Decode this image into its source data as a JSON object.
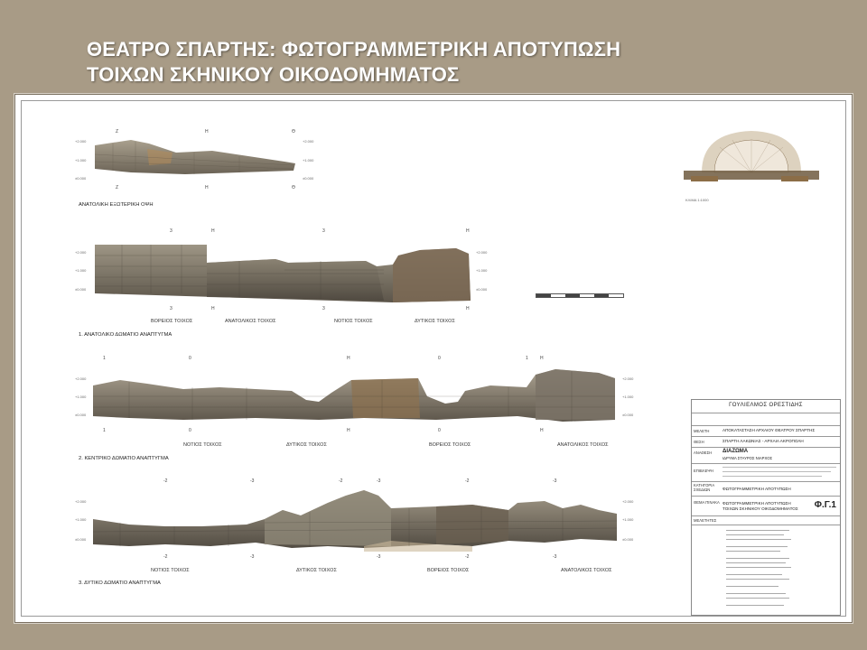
{
  "slide": {
    "title_line1": "ΘΕΑΤΡΟ ΣΠΑΡΤΗΣ: ΦΩΤΟΓΡΑΜΜΕΤΡΙΚΗ ΑΠΟΤΥΠΩΣΗ",
    "title_line2": "ΤΟΙΧΩΝ ΣΚΗΝΙΚΟΥ ΟΙΚΟΔΟΜΗΜΑΤΟΣ"
  },
  "sections": {
    "east_facade": {
      "title": "ΑΝΑΤΟΛΙΚΗ ΕΞΩΤΕΡΙΚΗ ΟΨΗ",
      "marks": [
        "Ζ",
        "Η",
        "Θ"
      ]
    },
    "room1": {
      "title": "1. ΑΝΑΤΟΛΙΚΟ ΔΩΜΑΤΙΟ ΑΝΑΠΤΥΓΜΑ",
      "marks": [
        "3",
        "Η",
        "3",
        "Η"
      ],
      "walls": [
        "ΒΟΡΕΙΟΣ ΤΟΙΧΟΣ",
        "ΑΝΑΤΟΛΙΚΟΣ ΤΟΙΧΟΣ",
        "ΝΟΤΙΟΣ ΤΟΙΧΟΣ",
        "ΔΥΤΙΚΟΣ ΤΟΙΧΟΣ"
      ]
    },
    "room2": {
      "title": "2. ΚΕΝΤΡΙΚΟ ΔΩΜΑΤΙΟ ΑΝΑΠΤΥΓΜΑ",
      "marks": [
        "1",
        "0",
        "Η",
        "0",
        "1",
        "Η"
      ],
      "walls": [
        "ΝΟΤΙΟΣ ΤΟΙΧΟΣ",
        "ΔΥΤΙΚΟΣ ΤΟΙΧΟΣ",
        "ΒΟΡΕΙΟΣ ΤΟΙΧΟΣ",
        "ΑΝΑΤΟΛΙΚΟΣ ΤΟΙΧΟΣ"
      ]
    },
    "room3": {
      "title": "3. ΔΥΤΙΚΟ ΔΩΜΑΤΙΟ ΑΝΑΠΤΥΓΜΑ",
      "marks": [
        "-2",
        "-3",
        "-2",
        "-3"
      ],
      "walls": [
        "ΝΟΤΙΟΣ ΤΟΙΧΟΣ",
        "ΔΥΤΙΚΟΣ ΤΟΙΧΟΣ",
        "ΒΟΡΕΙΟΣ ΤΟΙΧΟΣ",
        "ΑΝΑΤΟΛΙΚΟΣ ΤΟΙΧΟΣ"
      ]
    }
  },
  "key_plan": {
    "caption": "ΚΛΙΜΑ 1:1000"
  },
  "title_block": {
    "author": "ΓΟΥΛΙΕΛΜΟΣ ΟΡΕΣΤΙΔΗΣ",
    "label_project": "ΜΕΛΕΤΗ",
    "project": "ΑΠΟΚΑΤΑΣΤΑΣΗ ΑΡΧΑΙΟΥ ΘΕΑΤΡΟΥ ΣΠΑΡΤΗΣ",
    "label_location": "ΘΕΣΗ",
    "location": "ΣΠΑΡΤΗ ΛΑΚΩΝΙΑΣ - ΑΡΧΑΙΑ ΑΚΡΟΠΟΛΗ",
    "label_client": "ΑΝΑΘΕΣΗ",
    "client": "ΔΙΑΖΩΜΑ",
    "client_sub": "ΙΔΡΥΜΑ ΣΤΑΥΡΟΣ ΝΙΑΡΧΟΣ",
    "label_supervision": "ΕΠΙΒΛΕΨΗ",
    "label_category": "ΚΑΤΗΓΟΡΙΑ ΣΧΕΔΙΩΝ",
    "category": "ΦΩΤΟΓΡΑΜΜΕΤΡΙΚΗ ΑΠΟΤΥΠΩΣΗ",
    "label_subject": "ΘΕΜΑ ΠΙΝΑΚΑ",
    "subject": "ΦΩΤΟΓΡΑΜΜΕΤΡΙΚΗ ΑΠΟΤΥΠΩΣΗ ΤΟΙΧΩΝ ΣΚΗΝΙΚΟΥ ΟΙΚΟΔΟΜΗΜΑΤΟΣ",
    "sheet_no": "Φ.Γ.1",
    "label_team": "ΜΕΛΕΤΗΤΕΣ"
  },
  "colors": {
    "background": "#a89b86",
    "sheet": "#ffffff",
    "stone_light": "#b8ad9a",
    "stone_dark": "#5f574b",
    "earth": "#c9b79a"
  }
}
